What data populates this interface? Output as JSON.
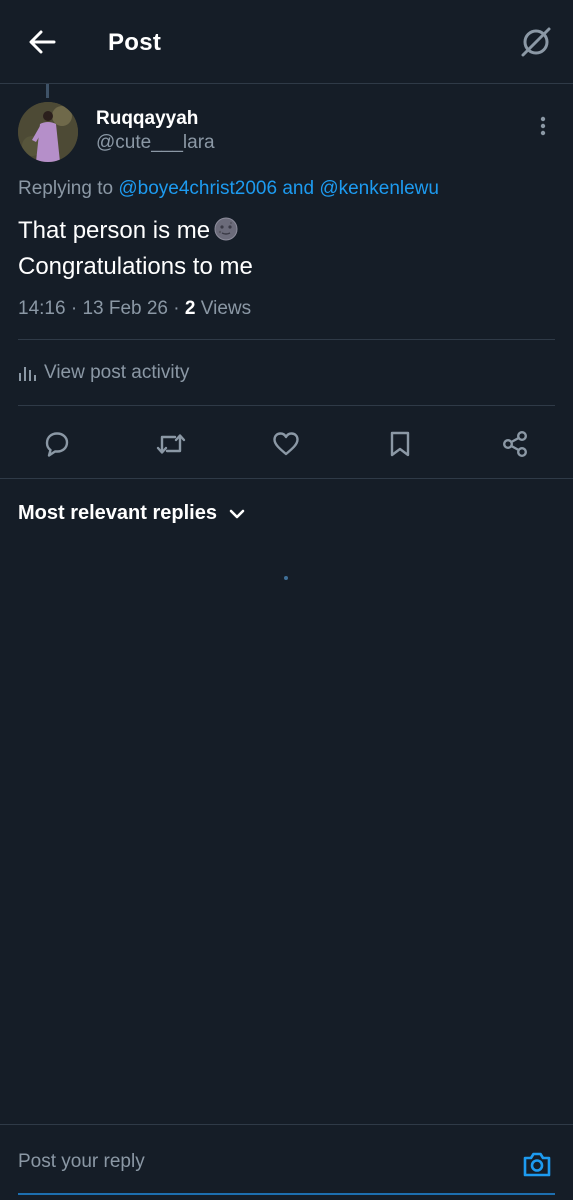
{
  "header": {
    "title": "Post",
    "back_icon": "arrow-left-icon",
    "grok_icon": "grok-icon"
  },
  "post": {
    "author": {
      "name": "Ruqqayyah",
      "handle": "@cute___lara"
    },
    "replying": {
      "prefix": "Replying to ",
      "target1": "@boye4christ2006",
      "joiner": " and ",
      "target2": "@kenkenlewu"
    },
    "text_line1": "That person is me",
    "text_emoji": "new-moon-face-emoji",
    "text_line2": "Congratulations to me",
    "time": "14:16",
    "sep1": " · ",
    "date": "13 Feb 26",
    "sep2": " · ",
    "views_count": "2",
    "views_label": " Views"
  },
  "activity": {
    "label": "View post activity",
    "icon": "bar-chart-icon"
  },
  "actions": [
    {
      "name": "reply",
      "icon": "comment-icon"
    },
    {
      "name": "repost",
      "icon": "repost-icon"
    },
    {
      "name": "like",
      "icon": "heart-icon"
    },
    {
      "name": "bookmark",
      "icon": "bookmark-icon"
    },
    {
      "name": "share",
      "icon": "share-icon"
    }
  ],
  "replies": {
    "sort_label": "Most relevant replies",
    "sort_icon": "chevron-down-icon"
  },
  "composer": {
    "placeholder": "Post your reply",
    "camera_icon": "camera-icon"
  },
  "colors": {
    "background": "#151d27",
    "accent": "#1d9bf0",
    "secondary_text": "#8b98a5",
    "divider": "#2f3a47"
  }
}
